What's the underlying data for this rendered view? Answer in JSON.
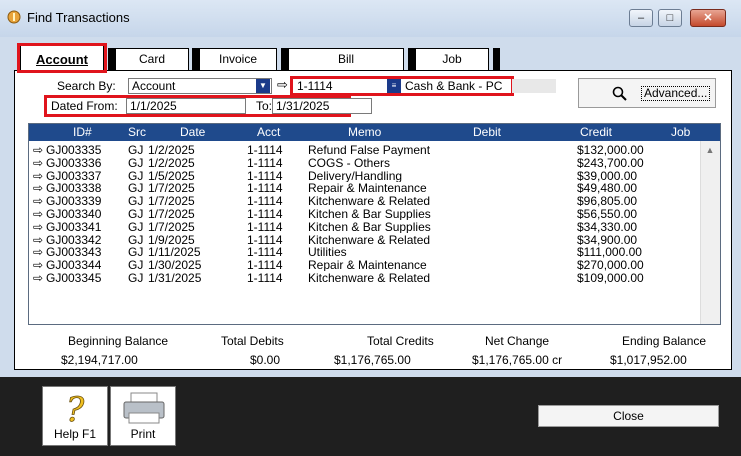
{
  "window": {
    "title": "Find Transactions",
    "min": "–",
    "max": "□",
    "close": "✕"
  },
  "tabs": [
    {
      "label": "Account",
      "selected": true
    },
    {
      "label": "Card"
    },
    {
      "label": "Invoice"
    },
    {
      "label": "Bill"
    },
    {
      "label": "Job"
    }
  ],
  "search": {
    "search_by_label": "Search By:",
    "search_by_value": "Account",
    "account_number": "1-1114",
    "account_name": "Cash & Bank - PC",
    "dated_from_label": "Dated From:",
    "dated_from_value": "1/1/2025",
    "to_label": "To:",
    "to_value": "1/31/2025",
    "advanced_label": "Advanced..."
  },
  "table": {
    "columns": [
      "ID#",
      "Src",
      "Date",
      "Acct",
      "Memo",
      "Debit",
      "Credit",
      "Job"
    ],
    "rows": [
      {
        "id": "GJ003335",
        "src": "GJ",
        "date": "1/2/2025",
        "acct": "1-1114",
        "memo": "Refund False Payment",
        "debit": "",
        "credit": "$132,000.00",
        "job": ""
      },
      {
        "id": "GJ003336",
        "src": "GJ",
        "date": "1/2/2025",
        "acct": "1-1114",
        "memo": "COGS - Others",
        "debit": "",
        "credit": "$243,700.00",
        "job": ""
      },
      {
        "id": "GJ003337",
        "src": "GJ",
        "date": "1/5/2025",
        "acct": "1-1114",
        "memo": "Delivery/Handling",
        "debit": "",
        "credit": "$39,000.00",
        "job": ""
      },
      {
        "id": "GJ003338",
        "src": "GJ",
        "date": "1/7/2025",
        "acct": "1-1114",
        "memo": "Repair & Maintenance",
        "debit": "",
        "credit": "$49,480.00",
        "job": ""
      },
      {
        "id": "GJ003339",
        "src": "GJ",
        "date": "1/7/2025",
        "acct": "1-1114",
        "memo": "Kitchenware & Related",
        "debit": "",
        "credit": "$96,805.00",
        "job": ""
      },
      {
        "id": "GJ003340",
        "src": "GJ",
        "date": "1/7/2025",
        "acct": "1-1114",
        "memo": "Kitchen & Bar Supplies",
        "debit": "",
        "credit": "$56,550.00",
        "job": ""
      },
      {
        "id": "GJ003341",
        "src": "GJ",
        "date": "1/7/2025",
        "acct": "1-1114",
        "memo": "Kitchen & Bar Supplies",
        "debit": "",
        "credit": "$34,330.00",
        "job": ""
      },
      {
        "id": "GJ003342",
        "src": "GJ",
        "date": "1/9/2025",
        "acct": "1-1114",
        "memo": "Kitchenware & Related",
        "debit": "",
        "credit": "$34,900.00",
        "job": ""
      },
      {
        "id": "GJ003343",
        "src": "GJ",
        "date": "1/11/2025",
        "acct": "1-1114",
        "memo": "Utilities",
        "debit": "",
        "credit": "$111,000.00",
        "job": ""
      },
      {
        "id": "GJ003344",
        "src": "GJ",
        "date": "1/30/2025",
        "acct": "1-1114",
        "memo": "Repair & Maintenance",
        "debit": "",
        "credit": "$270,000.00",
        "job": ""
      },
      {
        "id": "GJ003345",
        "src": "GJ",
        "date": "1/31/2025",
        "acct": "1-1114",
        "memo": "Kitchenware & Related",
        "debit": "",
        "credit": "$109,000.00",
        "job": ""
      }
    ]
  },
  "totals": {
    "beginning_label": "Beginning Balance",
    "beginning_value": "$2,194,717.00",
    "debits_label": "Total Debits",
    "debits_value": "$0.00",
    "credits_label": "Total Credits",
    "credits_value": "$1,176,765.00",
    "net_label": "Net Change",
    "net_value": "$1,176,765.00 cr",
    "ending_label": "Ending Balance",
    "ending_value": "$1,017,952.00"
  },
  "toolbar": {
    "help_label": "Help F1",
    "print_label": "Print",
    "close_label": "Close"
  },
  "colors": {
    "header_blue": "#1f4a8c",
    "highlight_red": "#e0141c",
    "window_bg": "#cfdcec"
  }
}
